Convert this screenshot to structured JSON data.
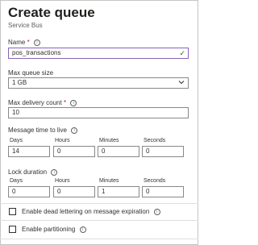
{
  "header": {
    "title": "Create queue",
    "subtitle": "Service Bus"
  },
  "fields": {
    "name": {
      "label": "Name",
      "required": "*",
      "value": "pos_transactions",
      "info_icon": "info-icon",
      "valid_icon": "checkmark-icon"
    },
    "max_queue_size": {
      "label": "Max queue size",
      "value": "1 GB"
    },
    "max_delivery_count": {
      "label": "Max delivery count",
      "required": "*",
      "value": "10"
    },
    "message_ttl": {
      "label": "Message time to live",
      "days_label": "Days",
      "days": "14",
      "hours_label": "Hours",
      "hours": "0",
      "minutes_label": "Minutes",
      "minutes": "0",
      "seconds_label": "Seconds",
      "seconds": "0"
    },
    "lock_duration": {
      "label": "Lock duration",
      "days_label": "Days",
      "days": "0",
      "hours_label": "Hours",
      "hours": "0",
      "minutes_label": "Minutes",
      "minutes": "1",
      "seconds_label": "Seconds",
      "seconds": "0"
    }
  },
  "options": {
    "dead_lettering": {
      "label": "Enable dead lettering on message expiration",
      "checked": false
    },
    "partitioning": {
      "label": "Enable partitioning",
      "checked": false
    }
  },
  "colors": {
    "accent": "#8764b8",
    "valid": "#107c10",
    "required": "#a4262c"
  }
}
